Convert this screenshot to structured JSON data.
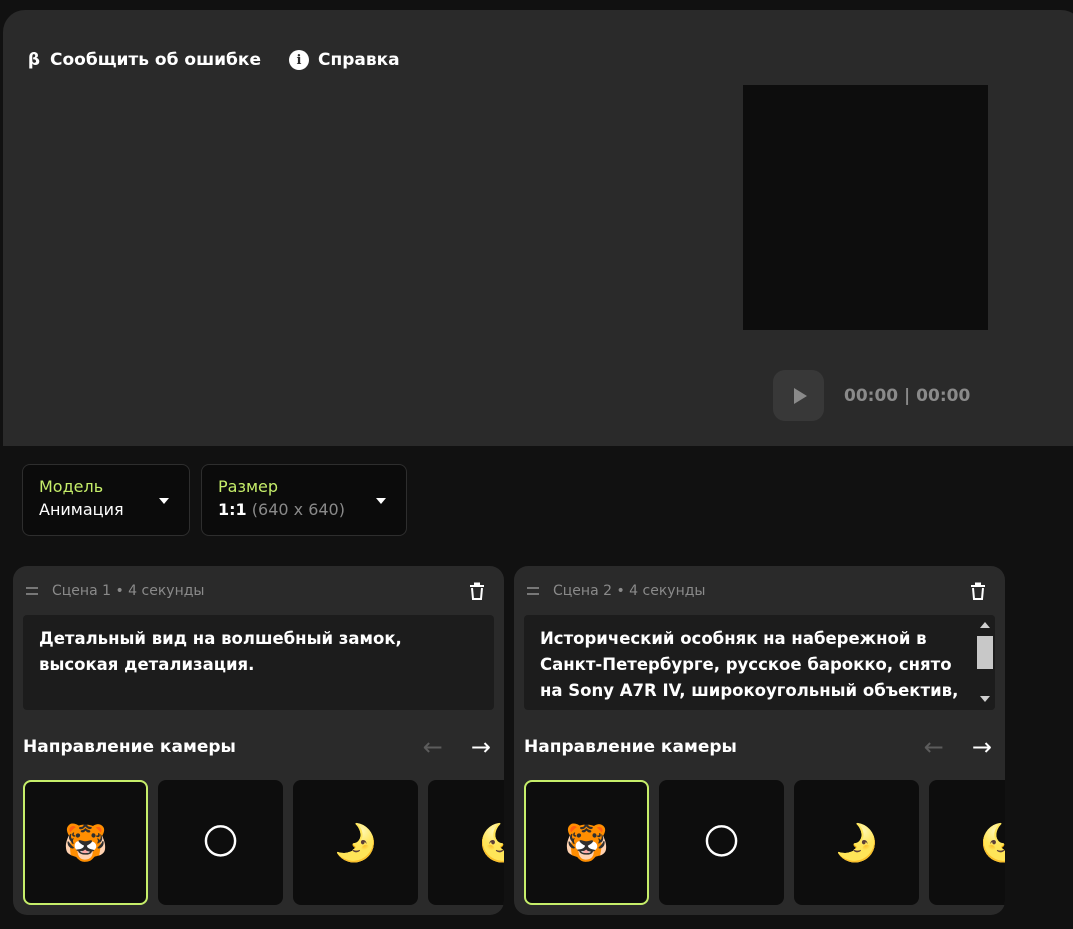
{
  "header": {
    "report_label": "Сообщить об ошибке",
    "report_icon": "β",
    "help_label": "Справка",
    "help_icon": "i"
  },
  "player": {
    "time": "00:00 | 00:00"
  },
  "selectors": {
    "model": {
      "label": "Модель",
      "value": "Анимация"
    },
    "size": {
      "label": "Размер",
      "value": "1:1",
      "detail": "(640 x 640)"
    }
  },
  "scenes": [
    {
      "title": "Сцена 1 • 4 секунды",
      "prompt": "Детальный вид на волшебный замок, высокая детализация.",
      "camera_label": "Направление камеры",
      "thumbs": [
        "🐯",
        "🌕",
        "🌛",
        "🌜"
      ]
    },
    {
      "title": "Сцена 2 • 4 секунды",
      "prompt": "Исторический особняк на набережной в Санкт-Петербурге, русское барокко, снято на Sony A7R IV, широкоугольный объектив,",
      "camera_label": "Направление камеры",
      "thumbs": [
        "🐯",
        "🌕",
        "🌛",
        "🌜"
      ]
    }
  ],
  "colors": {
    "accent": "#c6ee6a",
    "panel": "#2a2a2a",
    "background": "#111111"
  }
}
